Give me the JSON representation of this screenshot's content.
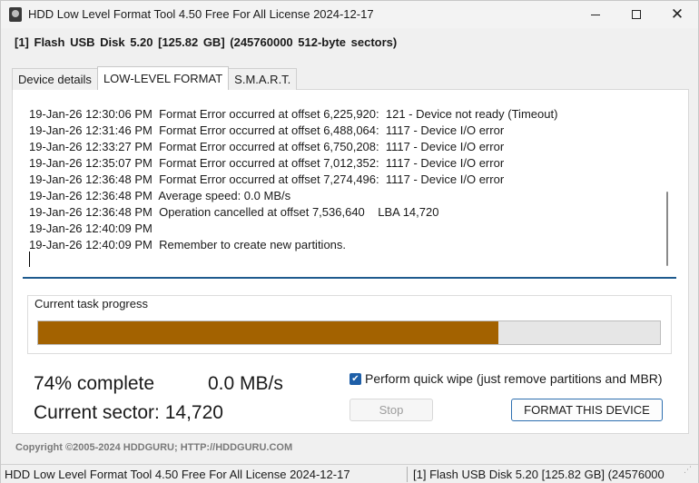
{
  "window": {
    "title": "HDD Low Level Format Tool 4.50    Free For All License 2024-12-17"
  },
  "device_header": "[1]  Flash USB Disk   5.20   [125.82 GB]   (245760000 512-byte sectors)",
  "tabs": [
    {
      "label": "Device details",
      "active": false
    },
    {
      "label": "LOW-LEVEL FORMAT",
      "active": true
    },
    {
      "label": "S.M.A.R.T.",
      "active": false
    }
  ],
  "log": {
    "lines": [
      "19-Jan-26 12:30:06 PM  Format Error occurred at offset 6,225,920:  121 - Device not ready (Timeout)",
      "19-Jan-26 12:31:46 PM  Format Error occurred at offset 6,488,064:  1117 - Device I/O error",
      "19-Jan-26 12:33:27 PM  Format Error occurred at offset 6,750,208:  1117 - Device I/O error",
      "19-Jan-26 12:35:07 PM  Format Error occurred at offset 7,012,352:  1117 - Device I/O error",
      "19-Jan-26 12:36:48 PM  Format Error occurred at offset 7,274,496:  1117 - Device I/O error",
      "19-Jan-26 12:36:48 PM  Average speed: 0.0 MB/s",
      "19-Jan-26 12:36:48 PM  Operation cancelled at offset 7,536,640    LBA 14,720",
      "19-Jan-26 12:40:09 PM",
      "19-Jan-26 12:40:09 PM  Remember to create new partitions."
    ]
  },
  "progress": {
    "label": "Current task progress",
    "fraction": 0.74,
    "fill_color": "#a36200"
  },
  "stats": {
    "percent_text": "74% complete",
    "speed_text": "0.0 MB/s",
    "sector_label": "Current sector:",
    "sector_value": "14,720"
  },
  "options": {
    "quick_wipe_label": "Perform quick wipe (just remove partitions and MBR)",
    "quick_wipe_checked": true
  },
  "buttons": {
    "stop_label": "Stop",
    "format_label": "FORMAT THIS DEVICE"
  },
  "copyright": "Copyright ©2005-2024 HDDGURU;  HTTP://HDDGURU.COM",
  "statusbar": {
    "left": "HDD Low Level Format Tool 4.50    Free For All License 2024-12-17",
    "right": "[1]  Flash USB Disk   5.20   [125.82 GB]   (24576000"
  },
  "icons": {
    "app": "hdd-icon",
    "minimize": "minimize-icon",
    "maximize": "maximize-icon",
    "close": "close-icon",
    "check": "checkmark-icon",
    "grip": "resize-grip-icon"
  },
  "colors": {
    "accent": "#1e5fa8",
    "progress": "#a36200"
  }
}
